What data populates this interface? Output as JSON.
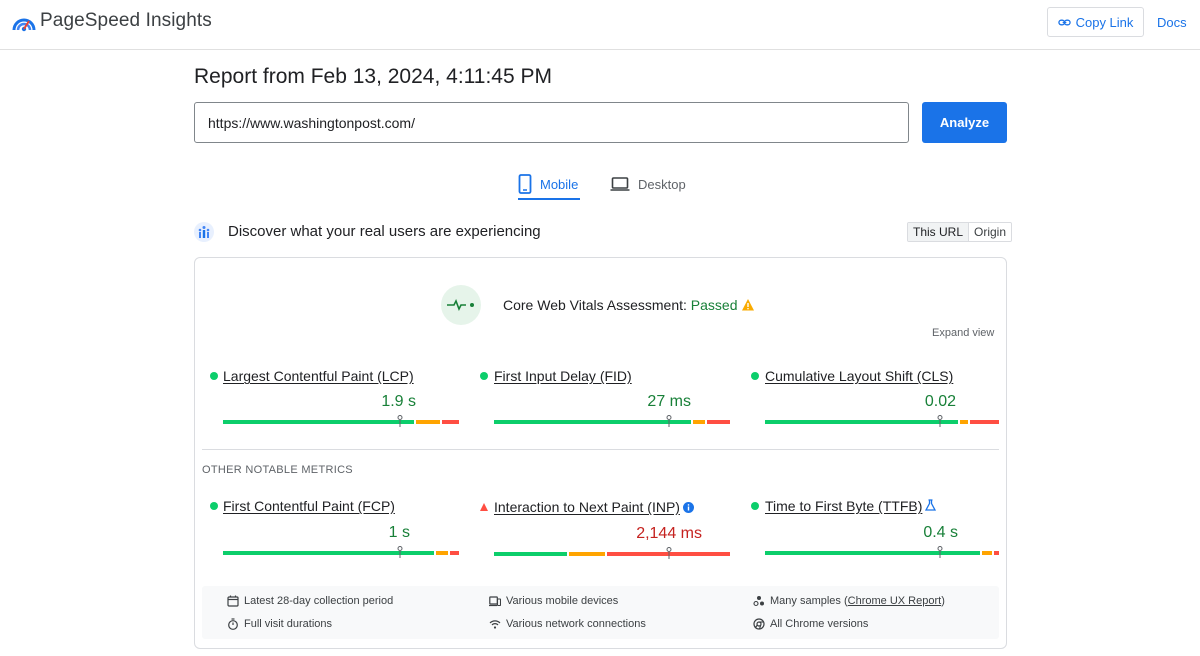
{
  "app": {
    "title": "PageSpeed Insights"
  },
  "header": {
    "copy_link_label": "Copy Link",
    "docs_label": "Docs"
  },
  "report": {
    "title": "Report from Feb 13, 2024, 4:11:45 PM"
  },
  "url_input": {
    "value": "https://www.washingtonpost.com/"
  },
  "analyze_label": "Analyze",
  "tabs": [
    {
      "label": "Mobile",
      "active": true
    },
    {
      "label": "Desktop",
      "active": false
    }
  ],
  "discover": {
    "text": "Discover what your real users are experiencing",
    "toggle": [
      "This URL",
      "Origin"
    ]
  },
  "cwv": {
    "label": "Core Web Vitals Assessment:",
    "status": "Passed",
    "expand_label": "Expand view"
  },
  "core_metrics": [
    {
      "label": "Largest Contentful Paint (LCP)",
      "value": "1.9 s",
      "status": "good"
    },
    {
      "label": "First Input Delay (FID)",
      "value": "27 ms",
      "status": "good"
    },
    {
      "label": "Cumulative Layout Shift (CLS)",
      "value": "0.02",
      "status": "good"
    }
  ],
  "other_heading": "OTHER NOTABLE METRICS",
  "other_metrics": [
    {
      "label": "First Contentful Paint (FCP)",
      "value": "1 s",
      "status": "good"
    },
    {
      "label": "Interaction to Next Paint (INP)",
      "value": "2,144 ms",
      "status": "poor"
    },
    {
      "label": "Time to First Byte (TTFB)",
      "value": "0.4 s",
      "status": "good"
    }
  ],
  "footer": {
    "collection": "Latest 28-day collection period",
    "durations": "Full visit durations",
    "devices": "Various mobile devices",
    "network": "Various network connections",
    "samples_prefix": "Many samples (",
    "samples_link": "Chrome UX Report",
    "samples_suffix": ")",
    "chrome": "All Chrome versions"
  },
  "colors": {
    "accent": "#1a73e8",
    "good": "#0cce6b",
    "average": "#ffa400",
    "poor": "#ff4e42"
  }
}
